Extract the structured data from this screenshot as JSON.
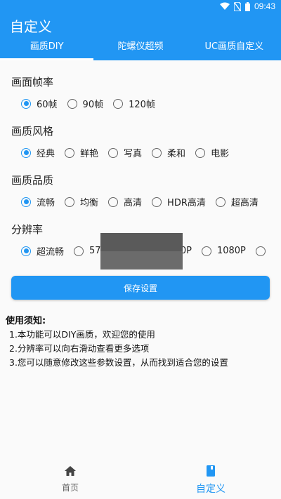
{
  "status_bar": {
    "time": "09:43"
  },
  "app_title": "自定义",
  "tabs": [
    {
      "label": "画质DIY",
      "active": true
    },
    {
      "label": "陀螺仪超频",
      "active": false
    },
    {
      "label": "UC画质自定义",
      "active": false
    }
  ],
  "sections": [
    {
      "title": "画面帧率",
      "options": [
        {
          "label": "60帧",
          "checked": true
        },
        {
          "label": "90帧",
          "checked": false
        },
        {
          "label": "120帧",
          "checked": false
        }
      ]
    },
    {
      "title": "画质风格",
      "options": [
        {
          "label": "经典",
          "checked": true
        },
        {
          "label": "鲜艳",
          "checked": false
        },
        {
          "label": "写真",
          "checked": false
        },
        {
          "label": "柔和",
          "checked": false
        },
        {
          "label": "电影",
          "checked": false
        }
      ]
    },
    {
      "title": "画质品质",
      "options": [
        {
          "label": "流畅",
          "checked": true
        },
        {
          "label": "均衡",
          "checked": false
        },
        {
          "label": "高清",
          "checked": false
        },
        {
          "label": "HDR高清",
          "checked": false
        },
        {
          "label": "超高清",
          "checked": false
        }
      ]
    },
    {
      "title": "分辨率",
      "options": [
        {
          "label": "超流畅",
          "checked": true
        },
        {
          "label": "57",
          "checked": false
        },
        {
          "label": "00P",
          "checked": false
        },
        {
          "label": "1080P",
          "checked": false
        },
        {
          "label": "",
          "checked": false
        }
      ]
    }
  ],
  "save_button": "保存设置",
  "notes": {
    "title": "使用须知:",
    "items": [
      "1.本功能可以DIY画质，欢迎您的使用",
      "2.分辨率可以向右滑动查看更多选项",
      "3.您可以随意修改这些参数设置，从而找到适合您的设置"
    ]
  },
  "bottom_nav": [
    {
      "label": "首页",
      "icon": "home-icon",
      "active": false
    },
    {
      "label": "自定义",
      "icon": "book-icon",
      "active": true
    }
  ],
  "colors": {
    "primary": "#2196f3"
  }
}
